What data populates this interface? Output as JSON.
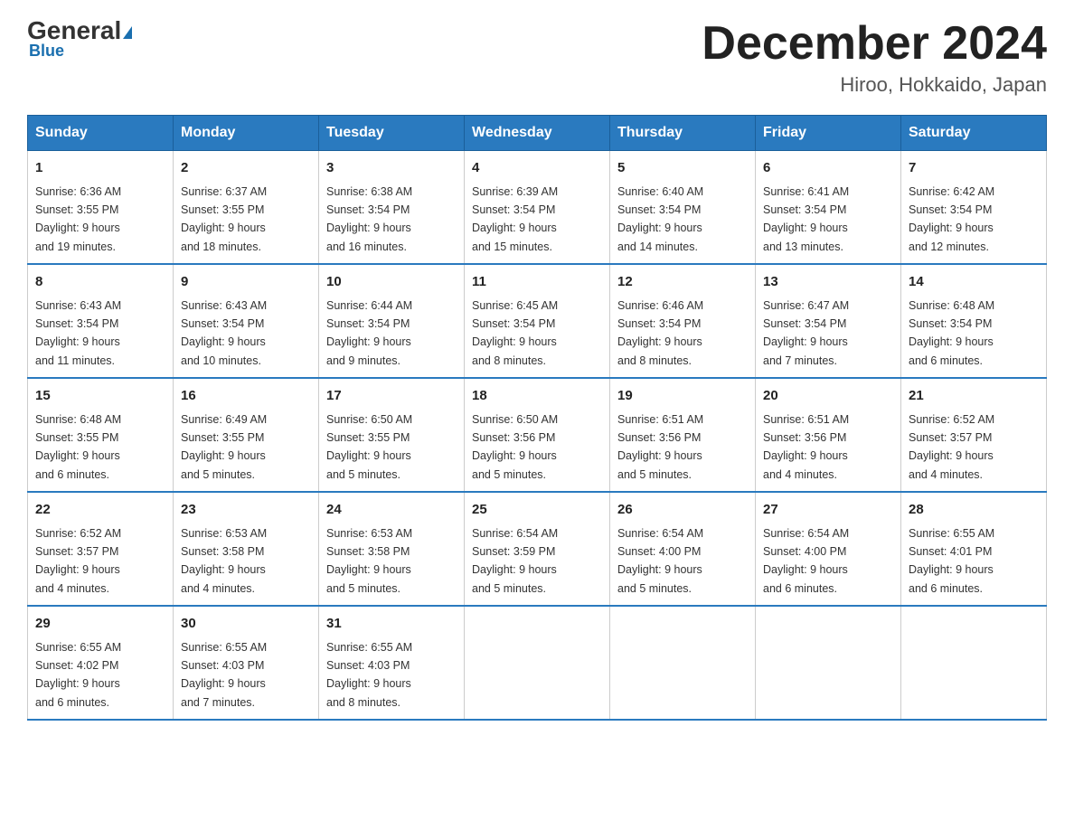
{
  "logo": {
    "general": "General",
    "blue": "Blue"
  },
  "title": "December 2024",
  "location": "Hiroo, Hokkaido, Japan",
  "days_of_week": [
    "Sunday",
    "Monday",
    "Tuesday",
    "Wednesday",
    "Thursday",
    "Friday",
    "Saturday"
  ],
  "weeks": [
    [
      {
        "day": "1",
        "sunrise": "6:36 AM",
        "sunset": "3:55 PM",
        "daylight": "9 hours and 19 minutes."
      },
      {
        "day": "2",
        "sunrise": "6:37 AM",
        "sunset": "3:55 PM",
        "daylight": "9 hours and 18 minutes."
      },
      {
        "day": "3",
        "sunrise": "6:38 AM",
        "sunset": "3:54 PM",
        "daylight": "9 hours and 16 minutes."
      },
      {
        "day": "4",
        "sunrise": "6:39 AM",
        "sunset": "3:54 PM",
        "daylight": "9 hours and 15 minutes."
      },
      {
        "day": "5",
        "sunrise": "6:40 AM",
        "sunset": "3:54 PM",
        "daylight": "9 hours and 14 minutes."
      },
      {
        "day": "6",
        "sunrise": "6:41 AM",
        "sunset": "3:54 PM",
        "daylight": "9 hours and 13 minutes."
      },
      {
        "day": "7",
        "sunrise": "6:42 AM",
        "sunset": "3:54 PM",
        "daylight": "9 hours and 12 minutes."
      }
    ],
    [
      {
        "day": "8",
        "sunrise": "6:43 AM",
        "sunset": "3:54 PM",
        "daylight": "9 hours and 11 minutes."
      },
      {
        "day": "9",
        "sunrise": "6:43 AM",
        "sunset": "3:54 PM",
        "daylight": "9 hours and 10 minutes."
      },
      {
        "day": "10",
        "sunrise": "6:44 AM",
        "sunset": "3:54 PM",
        "daylight": "9 hours and 9 minutes."
      },
      {
        "day": "11",
        "sunrise": "6:45 AM",
        "sunset": "3:54 PM",
        "daylight": "9 hours and 8 minutes."
      },
      {
        "day": "12",
        "sunrise": "6:46 AM",
        "sunset": "3:54 PM",
        "daylight": "9 hours and 8 minutes."
      },
      {
        "day": "13",
        "sunrise": "6:47 AM",
        "sunset": "3:54 PM",
        "daylight": "9 hours and 7 minutes."
      },
      {
        "day": "14",
        "sunrise": "6:48 AM",
        "sunset": "3:54 PM",
        "daylight": "9 hours and 6 minutes."
      }
    ],
    [
      {
        "day": "15",
        "sunrise": "6:48 AM",
        "sunset": "3:55 PM",
        "daylight": "9 hours and 6 minutes."
      },
      {
        "day": "16",
        "sunrise": "6:49 AM",
        "sunset": "3:55 PM",
        "daylight": "9 hours and 5 minutes."
      },
      {
        "day": "17",
        "sunrise": "6:50 AM",
        "sunset": "3:55 PM",
        "daylight": "9 hours and 5 minutes."
      },
      {
        "day": "18",
        "sunrise": "6:50 AM",
        "sunset": "3:56 PM",
        "daylight": "9 hours and 5 minutes."
      },
      {
        "day": "19",
        "sunrise": "6:51 AM",
        "sunset": "3:56 PM",
        "daylight": "9 hours and 5 minutes."
      },
      {
        "day": "20",
        "sunrise": "6:51 AM",
        "sunset": "3:56 PM",
        "daylight": "9 hours and 4 minutes."
      },
      {
        "day": "21",
        "sunrise": "6:52 AM",
        "sunset": "3:57 PM",
        "daylight": "9 hours and 4 minutes."
      }
    ],
    [
      {
        "day": "22",
        "sunrise": "6:52 AM",
        "sunset": "3:57 PM",
        "daylight": "9 hours and 4 minutes."
      },
      {
        "day": "23",
        "sunrise": "6:53 AM",
        "sunset": "3:58 PM",
        "daylight": "9 hours and 4 minutes."
      },
      {
        "day": "24",
        "sunrise": "6:53 AM",
        "sunset": "3:58 PM",
        "daylight": "9 hours and 5 minutes."
      },
      {
        "day": "25",
        "sunrise": "6:54 AM",
        "sunset": "3:59 PM",
        "daylight": "9 hours and 5 minutes."
      },
      {
        "day": "26",
        "sunrise": "6:54 AM",
        "sunset": "4:00 PM",
        "daylight": "9 hours and 5 minutes."
      },
      {
        "day": "27",
        "sunrise": "6:54 AM",
        "sunset": "4:00 PM",
        "daylight": "9 hours and 6 minutes."
      },
      {
        "day": "28",
        "sunrise": "6:55 AM",
        "sunset": "4:01 PM",
        "daylight": "9 hours and 6 minutes."
      }
    ],
    [
      {
        "day": "29",
        "sunrise": "6:55 AM",
        "sunset": "4:02 PM",
        "daylight": "9 hours and 6 minutes."
      },
      {
        "day": "30",
        "sunrise": "6:55 AM",
        "sunset": "4:03 PM",
        "daylight": "9 hours and 7 minutes."
      },
      {
        "day": "31",
        "sunrise": "6:55 AM",
        "sunset": "4:03 PM",
        "daylight": "9 hours and 8 minutes."
      },
      null,
      null,
      null,
      null
    ]
  ],
  "labels": {
    "sunrise": "Sunrise:",
    "sunset": "Sunset:",
    "daylight": "Daylight:"
  }
}
